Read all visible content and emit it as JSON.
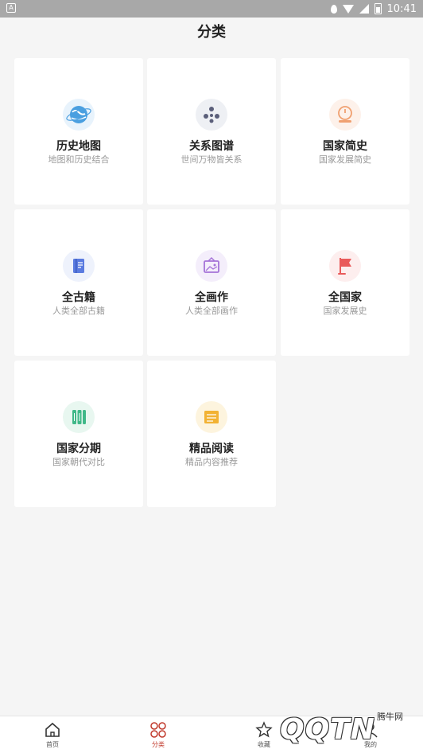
{
  "status_bar": {
    "time": "10:41",
    "battery_text": ""
  },
  "header": {
    "title": "分类"
  },
  "categories": [
    {
      "name": "历史地图",
      "desc": "地图和历史结合",
      "icon": "globe-icon",
      "color": "#4a9fe0",
      "bg": "#e8f3fc"
    },
    {
      "name": "关系图谱",
      "desc": "世间万物皆关系",
      "icon": "network-icon",
      "color": "#5b5f7a",
      "bg": "#eef0f4"
    },
    {
      "name": "国家简史",
      "desc": "国家发展简史",
      "icon": "clock-stand-icon",
      "color": "#f0a070",
      "bg": "#fdf1ea"
    },
    {
      "name": "全古籍",
      "desc": "人类全部古籍",
      "icon": "book-icon",
      "color": "#5a7be0",
      "bg": "#eef2fc"
    },
    {
      "name": "全画作",
      "desc": "人类全部画作",
      "icon": "frame-icon",
      "color": "#a573d8",
      "bg": "#f4eefb"
    },
    {
      "name": "全国家",
      "desc": "国家发展史",
      "icon": "flag-icon",
      "color": "#e95a5a",
      "bg": "#fdeeee"
    },
    {
      "name": "国家分期",
      "desc": "国家朝代对比",
      "icon": "columns-icon",
      "color": "#3fb888",
      "bg": "#e8f7f0"
    },
    {
      "name": "精品阅读",
      "desc": "精品内容推荐",
      "icon": "reading-icon",
      "color": "#f2b233",
      "bg": "#fdf4de"
    }
  ],
  "tabbar": {
    "items": [
      {
        "label": "首页",
        "icon": "home-icon"
      },
      {
        "label": "分类",
        "icon": "category-icon"
      },
      {
        "label": "收藏",
        "icon": "star-icon"
      },
      {
        "label": "我的",
        "icon": "user-icon"
      }
    ],
    "active_color": "#c0392b"
  },
  "watermark": {
    "logo_text": "QQTN",
    "site_text": "腾牛网"
  }
}
